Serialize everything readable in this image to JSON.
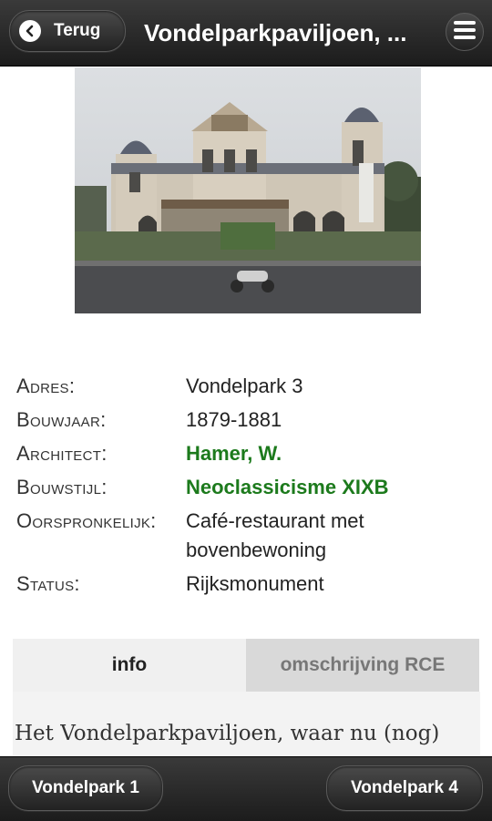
{
  "header": {
    "back_label": "Terug",
    "title": "Vondelparkpaviljoen, ...",
    "icons": {
      "back": "chevron-left-icon",
      "menu": "hamburger-menu-icon"
    }
  },
  "photo": {
    "subject": "Vondelparkpaviljoen building"
  },
  "details": {
    "adres_label": "Adres:",
    "adres_value": "Vondelpark 3",
    "bouwjaar_label": "Bouwjaar:",
    "bouwjaar_value": "1879-1881",
    "architect_label": "Architect:",
    "architect_value": "Hamer, W.",
    "bouwstijl_label": "Bouwstijl:",
    "bouwstijl_value": "Neoclassicisme XIXB",
    "oorspronkelijk_label": "Oorspronkelijk:",
    "oorspronkelijk_value_line1": "Café-restaurant met",
    "oorspronkelijk_value_line2": "bovenbewoning",
    "status_label": "Status:",
    "status_value": "Rijksmonument"
  },
  "tabs": [
    {
      "label": "info",
      "active": true
    },
    {
      "label": "omschrijving RCE",
      "active": false
    }
  ],
  "description_start": "Het Vondelparkpaviljoen, waar nu (nog)",
  "footer": {
    "prev_label": "Vondelpark 1",
    "next_label": "Vondelpark 4"
  },
  "colors": {
    "link_green": "#1c7a1c",
    "bar_dark": "#1c1c1c"
  }
}
